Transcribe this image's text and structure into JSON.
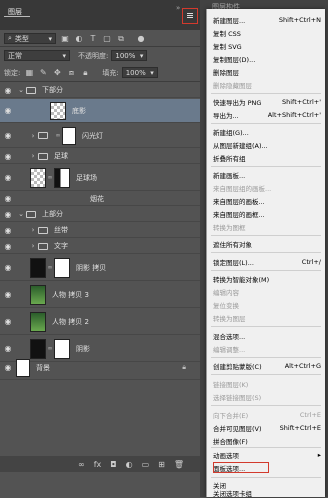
{
  "layers_panel": {
    "tab": "图层",
    "kind_filter": "类型",
    "blend_mode": "正常",
    "opacity_label": "不透明度:",
    "opacity_value": "100%",
    "lock_label": "锁定:",
    "fill_label": "填充:",
    "fill_value": "100%",
    "layers": [
      {
        "name": "下部分",
        "kind": "group",
        "indent": 0
      },
      {
        "name": "底影",
        "kind": "layer",
        "indent": 1,
        "selected": true
      },
      {
        "name": "闪光灯",
        "kind": "group",
        "indent": 1
      },
      {
        "name": "足球",
        "kind": "group",
        "indent": 1
      },
      {
        "name": "足球场",
        "kind": "layer",
        "indent": 1
      },
      {
        "name": "烟花",
        "kind": "layer",
        "indent": 1
      },
      {
        "name": "上部分",
        "kind": "group",
        "indent": 0
      },
      {
        "name": "丝带",
        "kind": "group",
        "indent": 1
      },
      {
        "name": "文字",
        "kind": "group",
        "indent": 1
      },
      {
        "name": "阴影 拷贝",
        "kind": "layer",
        "indent": 1
      },
      {
        "name": "人物 拷贝 3",
        "kind": "layer",
        "indent": 1
      },
      {
        "name": "人物 拷贝 2",
        "kind": "layer",
        "indent": 1
      },
      {
        "name": "阴影",
        "kind": "layer",
        "indent": 1
      },
      {
        "name": "背景",
        "kind": "layer",
        "indent": 0
      }
    ],
    "footer_fx": "fx"
  },
  "right_strip_header": "图层构件",
  "context_menu": {
    "items": [
      {
        "label": "新建图层...",
        "shortcut": "Shift+Ctrl+N",
        "disabled": false
      },
      {
        "label": "复制 CSS",
        "shortcut": "",
        "disabled": false
      },
      {
        "label": "复制 SVG",
        "shortcut": "",
        "disabled": false
      },
      {
        "label": "复制图层(D)...",
        "shortcut": "",
        "disabled": false
      },
      {
        "label": "删除图层",
        "shortcut": "",
        "disabled": false
      },
      {
        "label": "删除隐藏图层",
        "shortcut": "",
        "disabled": true
      },
      {
        "label": "快速导出为 PNG",
        "shortcut": "Shift+Ctrl+'",
        "disabled": false
      },
      {
        "label": "导出为...",
        "shortcut": "Alt+Shift+Ctrl+'",
        "disabled": false
      },
      {
        "label": "新建组(G)...",
        "shortcut": "",
        "disabled": false
      },
      {
        "label": "从图层新建组(A)...",
        "shortcut": "",
        "disabled": false
      },
      {
        "label": "折叠所有组",
        "shortcut": "",
        "disabled": false
      },
      {
        "label": "新建画板...",
        "shortcut": "",
        "disabled": false
      },
      {
        "label": "来自图层组的画板...",
        "shortcut": "",
        "disabled": true
      },
      {
        "label": "来自图层的画板...",
        "shortcut": "",
        "disabled": false
      },
      {
        "label": "来自图层的画框...",
        "shortcut": "",
        "disabled": false
      },
      {
        "label": "转换为图框",
        "shortcut": "",
        "disabled": true
      },
      {
        "label": "遮住所有对象",
        "shortcut": "",
        "disabled": false
      },
      {
        "label": "锁定图层(L)...",
        "shortcut": "Ctrl+/",
        "disabled": false
      },
      {
        "label": "转换为智能对象(M)",
        "shortcut": "",
        "disabled": false
      },
      {
        "label": "编辑内容",
        "shortcut": "",
        "disabled": true
      },
      {
        "label": "复位变换",
        "shortcut": "",
        "disabled": true
      },
      {
        "label": "转换为图层",
        "shortcut": "",
        "disabled": true
      },
      {
        "label": "混合选项...",
        "shortcut": "",
        "disabled": false
      },
      {
        "label": "编辑调整...",
        "shortcut": "",
        "disabled": true
      },
      {
        "label": "创建剪贴蒙版(C)",
        "shortcut": "Alt+Ctrl+G",
        "disabled": false
      },
      {
        "label": "链接图层(K)",
        "shortcut": "",
        "disabled": true
      },
      {
        "label": "选择链接图层(S)",
        "shortcut": "",
        "disabled": true
      },
      {
        "label": "向下合并(E)",
        "shortcut": "Ctrl+E",
        "disabled": true
      },
      {
        "label": "合并可见图层(V)",
        "shortcut": "Shift+Ctrl+E",
        "disabled": false
      },
      {
        "label": "拼合图像(F)",
        "shortcut": "",
        "disabled": false
      },
      {
        "label": "动画选项",
        "shortcut": "",
        "disabled": false
      },
      {
        "label": "面板选项...",
        "shortcut": "",
        "disabled": false
      },
      {
        "label": "关闭",
        "shortcut": "",
        "disabled": false
      },
      {
        "label": "关闭选项卡组",
        "shortcut": "",
        "disabled": false
      }
    ]
  },
  "colors": {
    "highlight_box": "#d23a2d",
    "selected_layer": "#6a7a8c"
  }
}
